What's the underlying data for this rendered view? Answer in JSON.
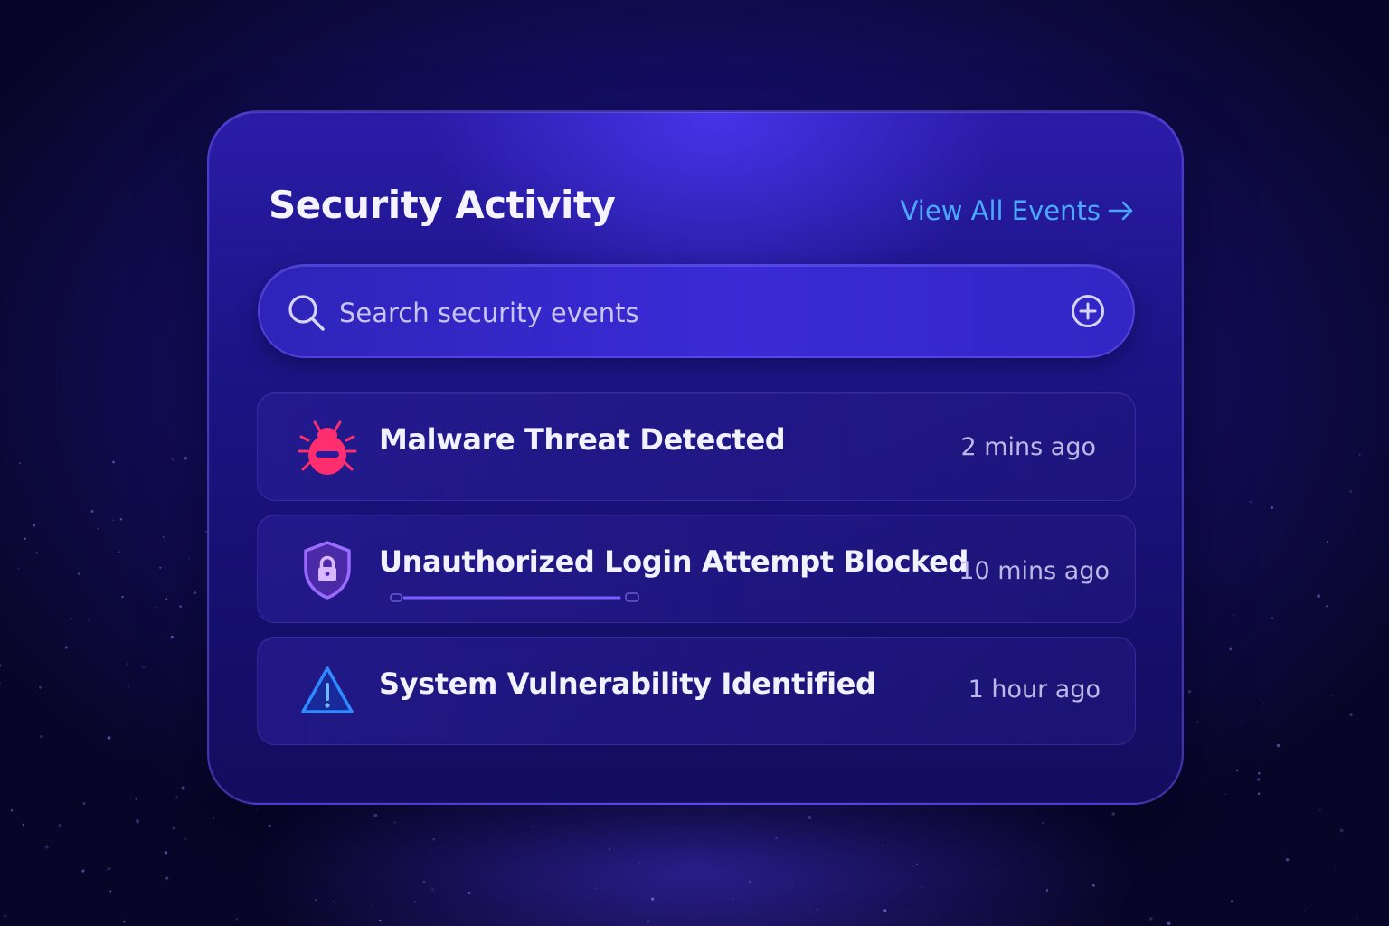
{
  "panel": {
    "title": "Security Activity",
    "view_all_label": "View All Events"
  },
  "search": {
    "placeholder": "Search security events",
    "value": ""
  },
  "events": [
    {
      "title": "Malware Threat Detected",
      "time": "2 mins ago",
      "icon": "bug-icon",
      "color": "#ff2e6e"
    },
    {
      "title": "Unauthorized Login Attempt Blocked",
      "time": "10 mins ago",
      "icon": "shield-lock-icon",
      "color": "#9b6bff",
      "progress": 1.0
    },
    {
      "title": "System Vulnerability Identified",
      "time": "1 hour ago",
      "icon": "warning-triangle-icon",
      "color": "#2f8bff"
    }
  ],
  "colors": {
    "accent": "#4aa8ff",
    "background": "#120c5c",
    "panel": "#1c1486"
  }
}
